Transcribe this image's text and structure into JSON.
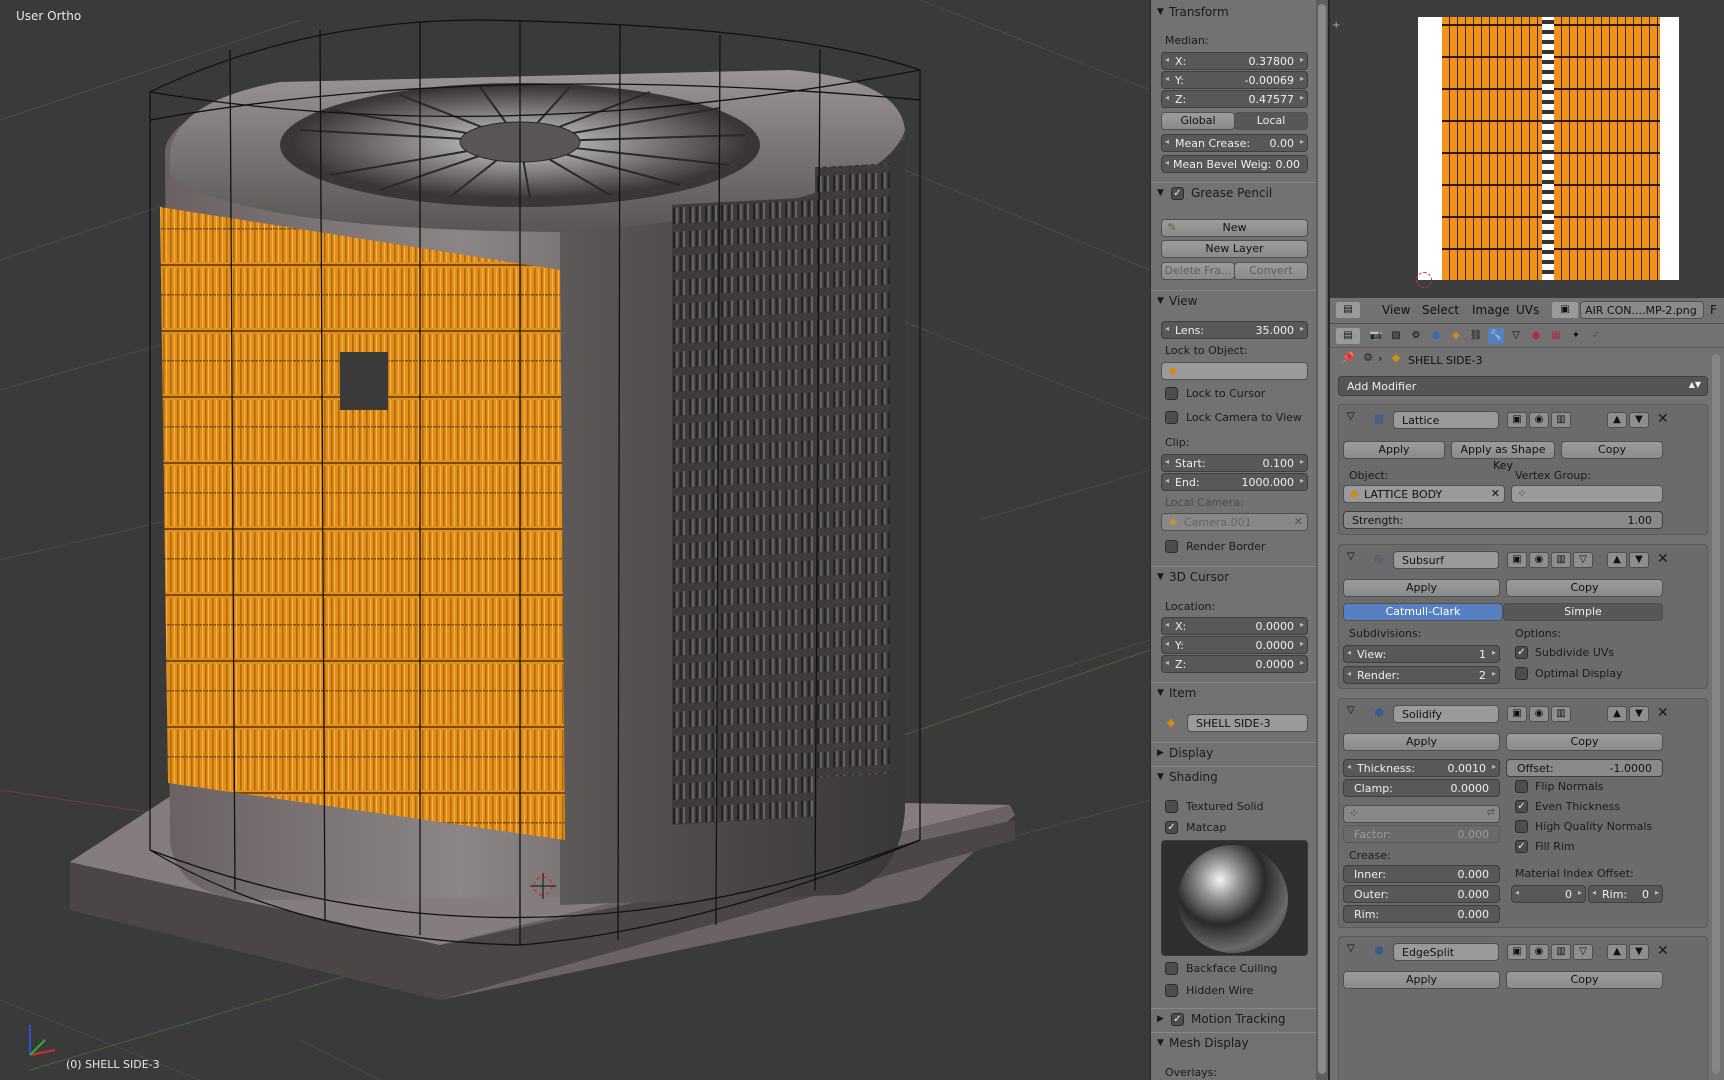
{
  "viewport": {
    "view_name": "User Ortho",
    "status_object": "(0) SHELL SIDE-3"
  },
  "npanel": {
    "transform": {
      "title": "Transform",
      "median_label": "Median:",
      "x_label": "X:",
      "x": "0.37800",
      "y_label": "Y:",
      "y": "-0.00069",
      "z_label": "Z:",
      "z": "0.47577",
      "global": "Global",
      "local": "Local",
      "mean_crease_label": "Mean Crease:",
      "mean_crease": "0.00",
      "mean_bevel_label": "Mean Bevel Weig:",
      "mean_bevel": "0.00"
    },
    "grease_pencil": {
      "title": "Grease Pencil",
      "new": "New",
      "new_layer": "New Layer",
      "delete_frame": "Delete Fra...",
      "convert": "Convert"
    },
    "view": {
      "title": "View",
      "lens_label": "Lens:",
      "lens": "35.000",
      "lock_to_object": "Lock to Object:",
      "lock_to_cursor": "Lock to Cursor",
      "lock_camera": "Lock Camera to View",
      "clip_label": "Clip:",
      "start_label": "Start:",
      "start": "0.100",
      "end_label": "End:",
      "end": "1000.000",
      "local_camera": "Local Camera:",
      "camera": "Camera.001",
      "render_border": "Render Border"
    },
    "cursor": {
      "title": "3D Cursor",
      "location_label": "Location:",
      "x_label": "X:",
      "x": "0.0000",
      "y_label": "Y:",
      "y": "0.0000",
      "z_label": "Z:",
      "z": "0.0000"
    },
    "item": {
      "title": "Item",
      "name": "SHELL SIDE-3"
    },
    "display": {
      "title": "Display"
    },
    "shading": {
      "title": "Shading",
      "textured_solid": "Textured Solid",
      "matcap": "Matcap",
      "backface_culling": "Backface Culling",
      "hidden_wire": "Hidden Wire"
    },
    "motion_tracking": {
      "title": "Motion Tracking"
    },
    "mesh_display": {
      "title": "Mesh Display",
      "overlays": "Overlays:"
    }
  },
  "image_header": {
    "menus": [
      "View",
      "Select",
      "Image",
      "UVs"
    ],
    "image_name": "AIR CON....MP-2.png",
    "f": "F"
  },
  "props": {
    "context_object": "SHELL SIDE-3",
    "add_modifier": "Add Modifier",
    "lattice": {
      "name": "Lattice",
      "apply": "Apply",
      "apply_shape": "Apply as Shape Key",
      "copy": "Copy",
      "object_label": "Object:",
      "object": "LATTICE BODY",
      "vgroup_label": "Vertex Group:",
      "strength_label": "Strength:",
      "strength": "1.00"
    },
    "subsurf": {
      "name": "Subsurf",
      "apply": "Apply",
      "copy": "Copy",
      "catmull": "Catmull-Clark",
      "simple": "Simple",
      "subdivisions_label": "Subdivisions:",
      "options_label": "Options:",
      "view_label": "View:",
      "view": "1",
      "render_label": "Render:",
      "render": "2",
      "subdivide_uvs": "Subdivide UVs",
      "optimal_display": "Optimal Display"
    },
    "solidify": {
      "name": "Solidify",
      "apply": "Apply",
      "copy": "Copy",
      "thickness_label": "Thickness:",
      "thickness": "0.0010",
      "offset_label": "Offset:",
      "offset": "-1.0000",
      "clamp_label": "Clamp:",
      "clamp": "0.0000",
      "flip_normals": "Flip Normals",
      "even_thickness": "Even Thickness",
      "hq_normals": "High Quality Normals",
      "fill_rim": "Fill Rim",
      "factor_label": "Factor:",
      "factor": "0.000",
      "crease_label": "Crease:",
      "inner_label": "Inner:",
      "inner": "0.000",
      "outer_label": "Outer:",
      "outer": "0.000",
      "rim_label": "Rim:",
      "rim": "0.000",
      "mat_offset_label": "Material Index Offset:",
      "mat_offset": "0",
      "rim2_label": "Rim:",
      "rim2": "0"
    },
    "edgesplit": {
      "name": "EdgeSplit",
      "apply": "Apply",
      "copy": "Copy"
    }
  },
  "colors": {
    "accent": "#5680c2",
    "selection": "#f39a1e",
    "panel": "#727272",
    "viewport": "#3a3a3a"
  }
}
